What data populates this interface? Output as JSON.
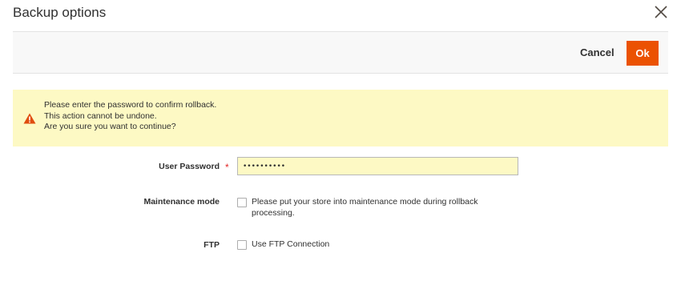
{
  "modal": {
    "title": "Backup options"
  },
  "toolbar": {
    "cancel_label": "Cancel",
    "ok_label": "Ok"
  },
  "notice": {
    "lines": [
      "Please enter the password to confirm rollback.",
      "This action cannot be undone.",
      "Are you sure you want to continue?"
    ],
    "icon": "warning-icon"
  },
  "form": {
    "password": {
      "label": "User Password",
      "required_marker": "*",
      "value": "••••••••••"
    },
    "maintenance": {
      "label": "Maintenance mode",
      "option_line1": "Please put your store into maintenance mode during rollback",
      "option_line2": "processing.",
      "checked": false
    },
    "ftp": {
      "label": "FTP",
      "option": "Use FTP Connection",
      "checked": false
    }
  },
  "colors": {
    "accent": "#eb5202",
    "notice_bg": "#fdf9c4",
    "warning_icon": "#e04d0f",
    "required": "#e22626"
  }
}
